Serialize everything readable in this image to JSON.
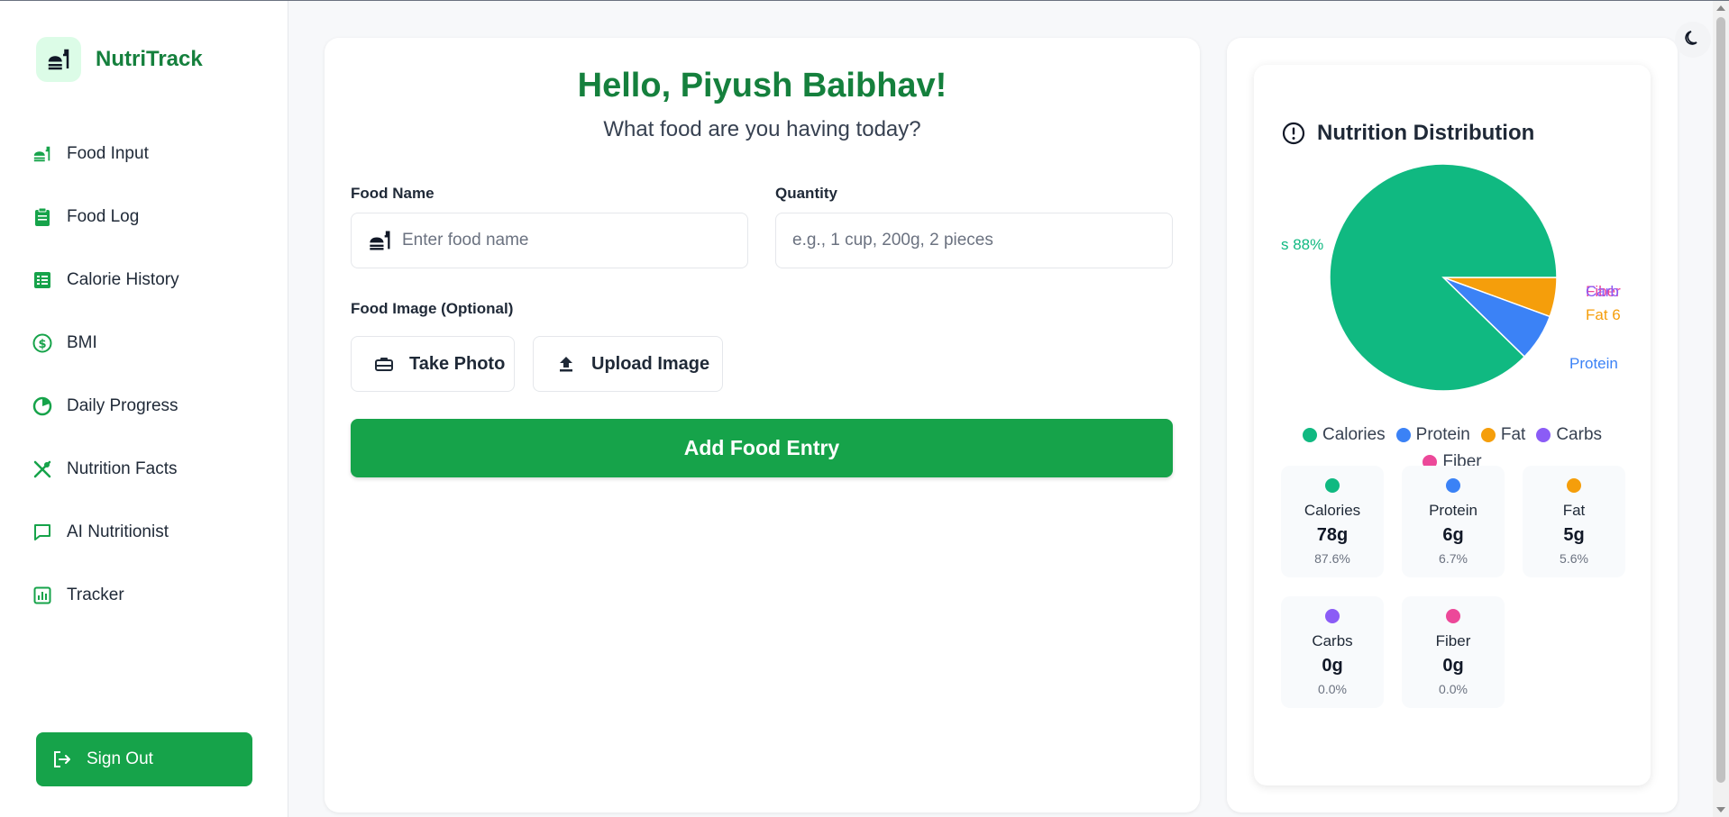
{
  "brand": {
    "name": "NutriTrack"
  },
  "sidebar": {
    "items": [
      {
        "label": "Food Input",
        "icon": "food-icon"
      },
      {
        "label": "Food Log",
        "icon": "clipboard-icon"
      },
      {
        "label": "Calorie History",
        "icon": "table-icon"
      },
      {
        "label": "BMI",
        "icon": "dollar-circle-icon"
      },
      {
        "label": "Daily Progress",
        "icon": "progress-circle-icon"
      },
      {
        "label": "Nutrition Facts",
        "icon": "utensils-icon"
      },
      {
        "label": "AI Nutritionist",
        "icon": "chat-icon"
      },
      {
        "label": "Tracker",
        "icon": "bar-chart-icon"
      }
    ],
    "signout_label": "Sign Out"
  },
  "main": {
    "greeting": "Hello, Piyush Baibhav!",
    "subtitle": "What food are you having today?",
    "food_name_label": "Food Name",
    "food_name_placeholder": "Enter food name",
    "food_name_value": "",
    "quantity_label": "Quantity",
    "quantity_placeholder": "e.g., 1 cup, 200g, 2 pieces",
    "quantity_value": "",
    "image_label": "Food Image (Optional)",
    "take_photo_label": "Take Photo",
    "upload_image_label": "Upload Image",
    "add_button_label": "Add Food Entry"
  },
  "distribution": {
    "title": "Nutrition Distribution",
    "pie_labels": {
      "calories": "s 88%",
      "fat": "Fat 6",
      "protein": "Protein",
      "carbs": "Carb",
      "fiber": "Fiber"
    },
    "stats": [
      {
        "name": "Calories",
        "value": "78g",
        "pct": "87.6%"
      },
      {
        "name": "Protein",
        "value": "6g",
        "pct": "6.7%"
      },
      {
        "name": "Fat",
        "value": "5g",
        "pct": "5.6%"
      },
      {
        "name": "Carbs",
        "value": "0g",
        "pct": "0.0%"
      },
      {
        "name": "Fiber",
        "value": "0g",
        "pct": "0.0%"
      }
    ]
  },
  "chart_data": {
    "type": "pie",
    "categories": [
      "Calories",
      "Protein",
      "Fat",
      "Carbs",
      "Fiber"
    ],
    "values": [
      87.6,
      6.7,
      5.6,
      0.0,
      0.0
    ],
    "colors": [
      "#10b981",
      "#3b82f6",
      "#f59e0b",
      "#8b5cf6",
      "#ec4899"
    ],
    "legend": "bottom"
  },
  "colors": {
    "brand": "#15803d",
    "primary_button": "#16a34a",
    "calories": "#10b981",
    "protein": "#3b82f6",
    "fat": "#f59e0b",
    "carbs": "#8b5cf6",
    "fiber": "#ec4899"
  }
}
